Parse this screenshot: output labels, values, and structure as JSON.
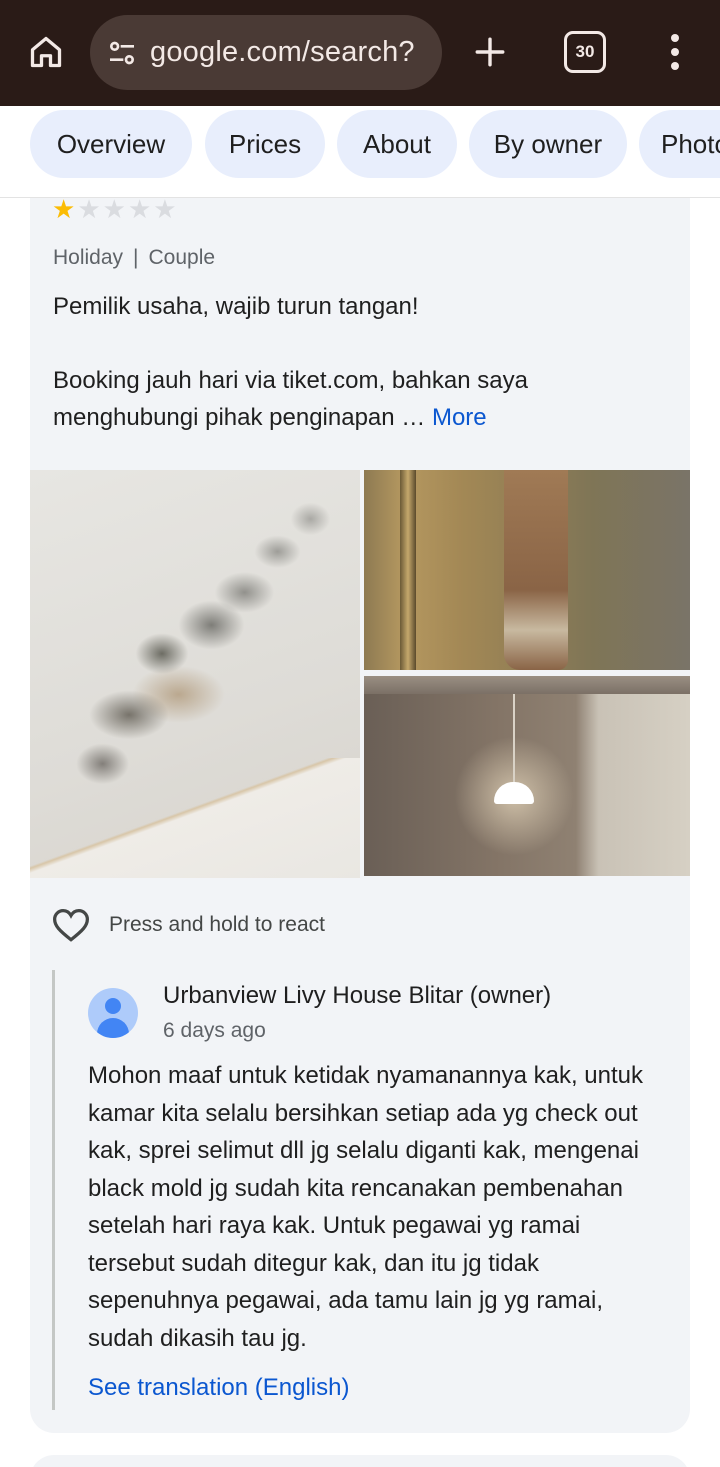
{
  "browser": {
    "url": "google.com/search?",
    "tab_count": "30",
    "icons": [
      "home-icon",
      "site-settings-icon",
      "new-tab-plus-icon",
      "tab-switcher-icon",
      "more-vert-icon"
    ]
  },
  "chips": [
    {
      "label": "Overview"
    },
    {
      "label": "Prices"
    },
    {
      "label": "About"
    },
    {
      "label": "By owner"
    },
    {
      "label": "Photos"
    }
  ],
  "review": {
    "rating": 1,
    "rating_max": 5,
    "trip_type": "Holiday",
    "separator": "|",
    "group": "Couple",
    "title": "Pemilik usaha, wajib turun tangan!",
    "snippet": "Booking jauh hari via tiket.com, bahkan saya menghubungi pihak penginapan …",
    "more_label": "More",
    "photos": [
      "mold-on-ceiling",
      "towel-on-door",
      "pendant-lamp"
    ],
    "react_label": "Press and hold to react"
  },
  "owner_reply": {
    "name": "Urbanview Livy House Blitar (owner)",
    "time": "6 days ago",
    "text": "Mohon maaf untuk ketidak nyamanannya kak, untuk kamar kita selalu bersihkan setiap ada yg check out kak, sprei selimut dll jg selalu diganti kak, mengenai black mold jg sudah kita rencanakan pembenahan setelah hari raya kak. Untuk pegawai yg ramai tersebut sudah ditegur kak, dan itu jg tidak sepenuhnya pegawai, ada tamu lain jg yg ramai, sudah dikasih tau jg.",
    "translate_label": "See translation (English)"
  },
  "colors": {
    "topbar": "#2a1b17",
    "chip_bg": "#e8eefc",
    "card_bg": "#f2f4f7",
    "link": "#0b57d0",
    "star": "#fbbc04"
  }
}
